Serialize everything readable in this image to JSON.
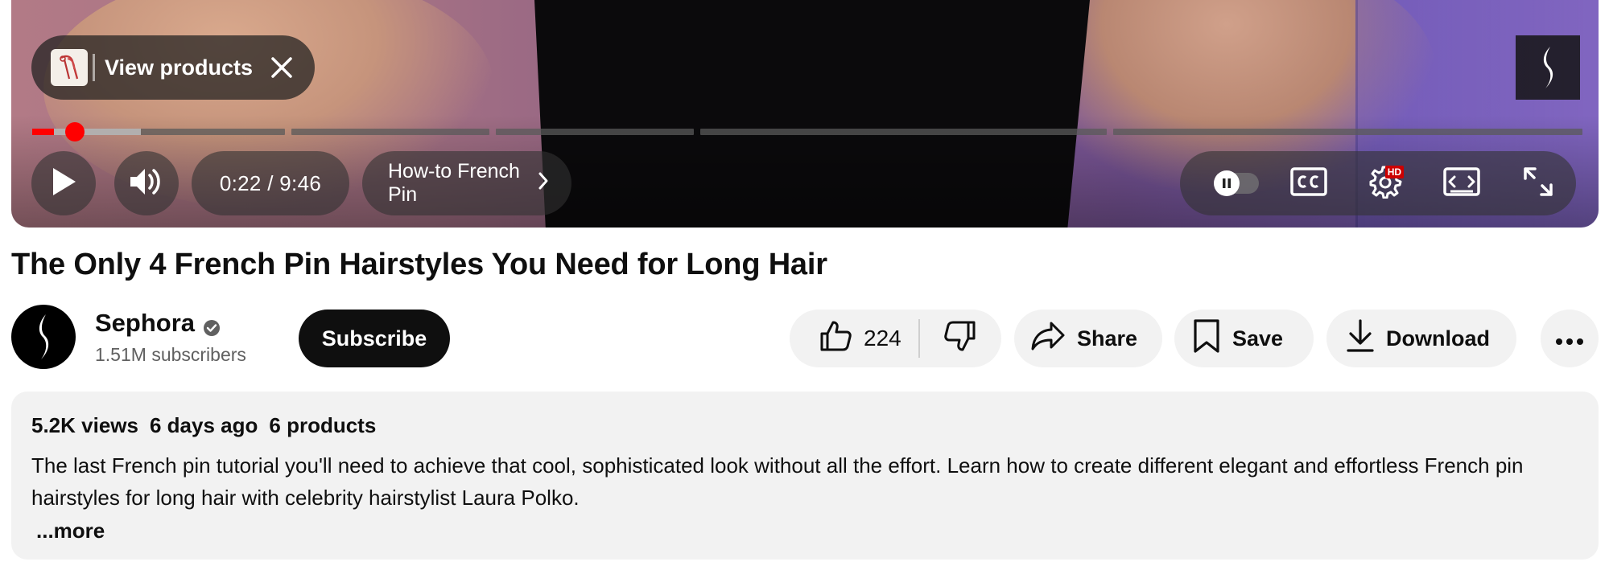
{
  "player": {
    "view_products_label": "View products",
    "time_current": "0:22",
    "time_separator": " / ",
    "time_total": "9:46",
    "chapter_title": "How-to French Pin",
    "progress": {
      "played_fraction": 0.014,
      "buffered_fraction": 0.07,
      "chapter_boundaries": [
        0.165,
        0.297,
        0.429,
        0.695,
        1.0
      ]
    },
    "hd_badge": "HD",
    "colors": {
      "progress_played": "#ff0000",
      "hd_badge": "#cc0000"
    },
    "icons": [
      "product-thumb-icon",
      "close-icon",
      "sephora-watermark-icon",
      "play-icon",
      "volume-icon",
      "chevron-right-icon",
      "autoplay-toggle-icon",
      "captions-icon",
      "settings-icon",
      "theater-mode-icon",
      "fullscreen-icon"
    ]
  },
  "video": {
    "title": "The Only 4 French Pin Hairstyles You Need for Long Hair"
  },
  "channel": {
    "name": "Sephora",
    "subscribers": "1.51M subscribers",
    "subscribe_label": "Subscribe"
  },
  "actions": {
    "like_count": "224",
    "share_label": "Share",
    "save_label": "Save",
    "download_label": "Download"
  },
  "description": {
    "views": "5.2K views",
    "age": "6 days ago",
    "products": "6 products",
    "text": "The last French pin tutorial you'll need to achieve that cool, sophisticated look without all the effort. Learn how to create different elegant and effortless French pin hairstyles for long hair with celebrity hairstylist Laura Polko.",
    "more_label": "...more"
  }
}
